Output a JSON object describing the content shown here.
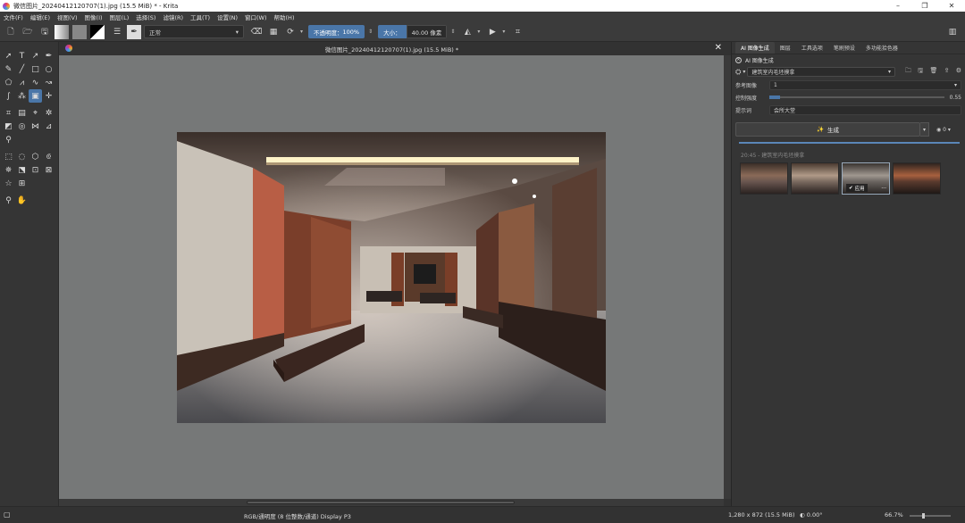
{
  "window": {
    "title": "微信图片_20240412120707(1).jpg (15.5 MiB) * - Krita",
    "min_icon": "minimize-icon",
    "max_icon": "maximize-icon",
    "close_icon": "close-icon"
  },
  "menu": [
    "文件(F)",
    "编辑(E)",
    "视图(V)",
    "图像(I)",
    "图层(L)",
    "选择(S)",
    "滤镜(R)",
    "工具(T)",
    "设置(N)",
    "窗口(W)",
    "帮助(H)"
  ],
  "toolbar": {
    "blend_mode": "正常",
    "opacity_label": "不透明度：",
    "opacity_value": "100%",
    "size_label": "大小：",
    "size_value": "40.00 像素"
  },
  "document": {
    "tab_title": "微信图片_20240412120707(1).jpg (15.5 MiB) *",
    "close_symbol": "✕"
  },
  "dock": {
    "tabs": [
      "AI 图像生成",
      "图层",
      "工具选项",
      "笔刷预设",
      "多功能拾色器"
    ],
    "panel_title": "AI 图像生成",
    "workspace": "建筑室内毛坯摸拿",
    "reference_label": "参考图像",
    "reference_value": "1",
    "control_label": "控制强度",
    "control_value": "0.55",
    "prompt_label": "提示词",
    "prompt_value": "会所大堂",
    "generate_label": "生成",
    "count_value": "0",
    "history_title": "20:45 - 建筑室内毛坯摸拿",
    "apply_label": "应用",
    "more_label": "···"
  },
  "status": {
    "color_info": "RGB/通明度 (8 位整数/通道)  Display P3",
    "dimensions": "1,280 x 872 (15.5 MiB)",
    "rotation": "0.00°",
    "zoom": "66.7%"
  },
  "tools": [
    "select-shapes-icon",
    "text-icon",
    "edit-shapes-icon",
    "calligraphy-icon",
    "brush-icon",
    "line-icon",
    "rectangle-icon",
    "ellipse-icon",
    "polygon-icon",
    "polyline-icon",
    "bezier-icon",
    "freehand-path-icon",
    "dynamic-brush-icon",
    "multibrush-icon",
    "transform-icon",
    "move-icon",
    "crop-icon",
    "gradient-icon",
    "color-picker-icon",
    "smart-patch-icon",
    "fill-icon",
    "enclose-fill-icon",
    "assistant-icon",
    "measure-icon",
    "reference-icon",
    "rect-select-icon",
    "ellipse-select-icon",
    "polygon-select-icon",
    "freehand-select-icon",
    "contiguous-select-icon",
    "similar-select-icon",
    "bezier-select-icon",
    "magnetic-select-icon",
    "magic-wand-icon",
    "grid-icon",
    "zoom-icon",
    "pan-icon"
  ]
}
